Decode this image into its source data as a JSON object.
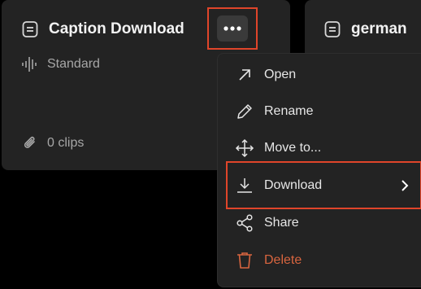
{
  "cards": [
    {
      "title": "Caption Download",
      "type_label": "Standard",
      "clips_label": "0 clips",
      "icon": "document-icon"
    },
    {
      "title": "german",
      "icon": "document-icon"
    }
  ],
  "more_button": {
    "icon": "more-horizontal-icon"
  },
  "menu": {
    "items": [
      {
        "label": "Open",
        "icon": "open-arrow-icon"
      },
      {
        "label": "Rename",
        "icon": "pencil-icon"
      },
      {
        "label": "Move to...",
        "icon": "move-icon"
      },
      {
        "label": "Download",
        "icon": "download-icon",
        "submenu": true
      },
      {
        "label": "Share",
        "icon": "share-icon"
      },
      {
        "label": "Delete",
        "icon": "trash-icon"
      }
    ]
  },
  "colors": {
    "background": "#000000",
    "card": "#232323",
    "highlight": "#e0452a",
    "delete": "#d8653f",
    "text": "#f2f2f2",
    "muted": "#a7a7a7"
  }
}
